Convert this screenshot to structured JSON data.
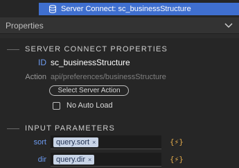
{
  "tree": {
    "item_label": "Server Connect: sc_businessStructure",
    "icon": "database-icon"
  },
  "properties_panel": {
    "header": "Properties",
    "server_connect_section": {
      "title": "SERVER CONNECT PROPERTIES",
      "id_label": "ID",
      "id_value": "sc_businessStructure",
      "action_label": "Action",
      "action_value": "api/preferences/businessStructure",
      "select_button_label": "Select Server Action",
      "no_auto_load_label": "No Auto Load",
      "no_auto_load_checked": false
    },
    "input_parameters": {
      "title": "INPUT PARAMETERS",
      "params": [
        {
          "name": "sort",
          "value": "query.sort",
          "remove": "×",
          "dynamic_icon": "{⚡}"
        },
        {
          "name": "dir",
          "value": "query.dir",
          "remove": "×",
          "dynamic_icon": "{⚡}"
        }
      ]
    }
  },
  "colors": {
    "accent_selection": "#3f6fcf",
    "label_blue": "#6d9bf0",
    "bolt_orange": "#e0a84a"
  }
}
